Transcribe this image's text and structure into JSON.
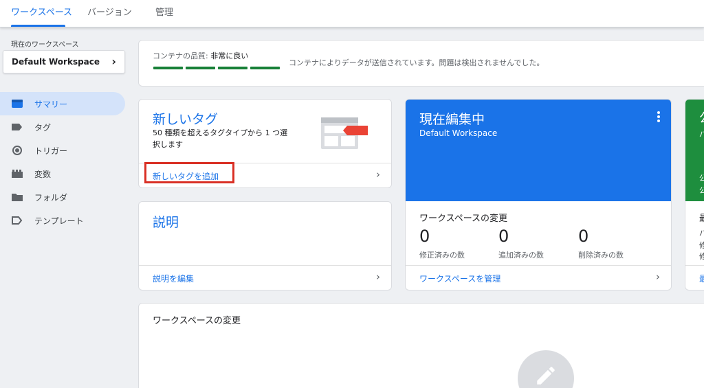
{
  "tabs": [
    {
      "label": "ワークスペース",
      "active": true
    },
    {
      "label": "バージョン",
      "active": false
    },
    {
      "label": "管理",
      "active": false
    }
  ],
  "sidebar": {
    "caption": "現在のワークスペース",
    "workspace": "Default Workspace",
    "items": [
      {
        "label": "サマリー",
        "icon": "summary-icon",
        "active": true
      },
      {
        "label": "タグ",
        "icon": "tag-icon",
        "active": false
      },
      {
        "label": "トリガー",
        "icon": "trigger-icon",
        "active": false
      },
      {
        "label": "変数",
        "icon": "variables-icon",
        "active": false
      },
      {
        "label": "フォルダ",
        "icon": "folder-icon",
        "active": false
      },
      {
        "label": "テンプレート",
        "icon": "template-icon",
        "active": false
      }
    ]
  },
  "quality": {
    "label": "コンテナの品質: ",
    "value": "非常に良い",
    "message": "コンテナによりデータが送信されています。問題は検出されませんでした。",
    "bar_color": "#188038"
  },
  "new_tag": {
    "title": "新しいタグ",
    "description": "50 種類を超えるタグタイプから 1 つ選択します",
    "link": "新しいタグを追加"
  },
  "description_card": {
    "title": "説明",
    "link": "説明を編集"
  },
  "editing": {
    "title": "現在編集中",
    "workspace": "Default Workspace",
    "changes_title": "ワークスペースの変更",
    "stats": [
      {
        "value": "0",
        "label": "修正済みの数"
      },
      {
        "value": "0",
        "label": "追加済みの数"
      },
      {
        "value": "0",
        "label": "削除済みの数"
      }
    ],
    "link": "ワークスペースを管理",
    "header_color": "#1a73e8"
  },
  "green_card": {
    "header_chars": [
      "公",
      "バ",
      "公",
      "公"
    ],
    "body_chars": [
      "最",
      "バ",
      "修",
      "修"
    ],
    "footer_char": "最",
    "header_color": "#1e8e3e"
  },
  "changes_section": {
    "title": "ワークスペースの変更"
  },
  "colors": {
    "accent": "#1a73e8",
    "highlight_border": "#d93025",
    "tag_icon_red": "#ea4335"
  }
}
